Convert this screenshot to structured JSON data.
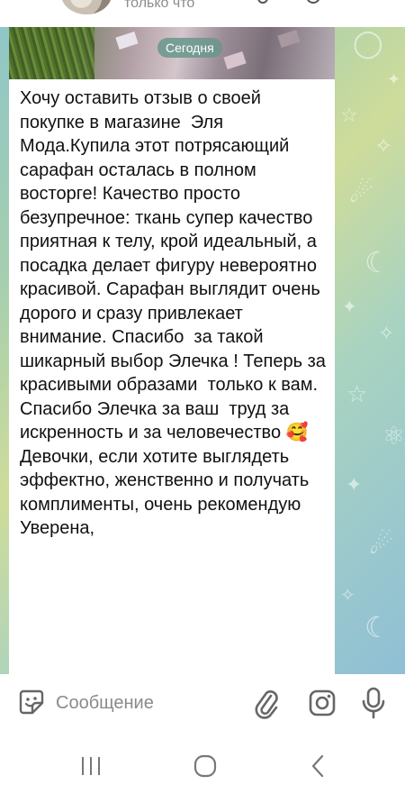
{
  "header": {
    "status": "только что"
  },
  "chat": {
    "date_label": "Сегодня",
    "message_text": "Хочу оставить отзыв о своей покупке в магазине  Эля Мода.Купила этот потрясающий сарафан осталась в полном восторге! Качество просто безупречное: ткань супер качество приятная к телу, крой идеальный, а посадка делает фигуру невероятно красивой. Сарафан выглядит очень дорого и сразу привлекает внимание. Спасибо  за такой шикарный выбор Элечка ! Теперь за красивыми образами  только к вам. Спасибо Элечка за ваш  труд за искренность и за человечество 🥰 Девочки, если хотите выглядеть эффектно, женственно и получать комплименты, очень рекомендую Уверена,"
  },
  "input": {
    "placeholder": "Сообщение"
  },
  "icons": {
    "sticker": "sticker-icon",
    "attach": "paperclip-icon",
    "camera": "instagram-camera-icon",
    "mic": "microphone-icon",
    "nav_recent": "recent-apps-icon",
    "nav_home": "home-icon",
    "nav_back": "back-icon"
  },
  "colors": {
    "icon": "#666666",
    "date_pill": "#68968c",
    "placeholder": "#8a8a8a"
  }
}
